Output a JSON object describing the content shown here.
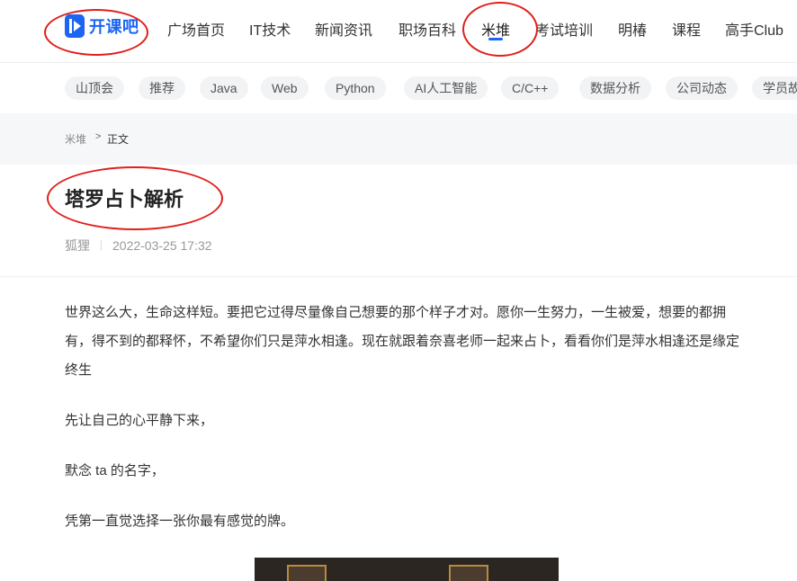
{
  "logo": {
    "text": "开课吧",
    "brand_color": "#1c64f2"
  },
  "nav": {
    "items": [
      {
        "label": "广场首页"
      },
      {
        "label": "IT技术"
      },
      {
        "label": "新闻资讯"
      },
      {
        "label": "职场百科"
      },
      {
        "label": "米堆",
        "active": true
      },
      {
        "label": "考试培训"
      },
      {
        "label": "明椿"
      },
      {
        "label": "课程"
      },
      {
        "label": "高手Club"
      }
    ]
  },
  "tags": [
    "山顶会",
    "推荐",
    "Java",
    "Web",
    "Python",
    "AI人工智能",
    "C/C++",
    "数据分析",
    "公司动态",
    "学员故事"
  ],
  "breadcrumb": {
    "parent": "米堆",
    "separator": ">",
    "current": "正文"
  },
  "article": {
    "title": "塔罗占卜解析",
    "author": "狐狸",
    "date": "2022-03-25 17:32",
    "paragraphs": [
      "世界这么大，生命这样短。要把它过得尽量像自己想要的那个样子才对。愿你一生努力，一生被爱，想要的都拥有，得不到的都释怀，不希望你们只是萍水相逢。现在就跟着奈喜老师一起来占卜，看看你们是萍水相逢还是缘定终生",
      "先让自己的心平静下来，",
      "默念 ta 的名字，",
      "凭第一直觉选择一张你最有感觉的牌。"
    ]
  },
  "annotation_color": "#e0201b"
}
